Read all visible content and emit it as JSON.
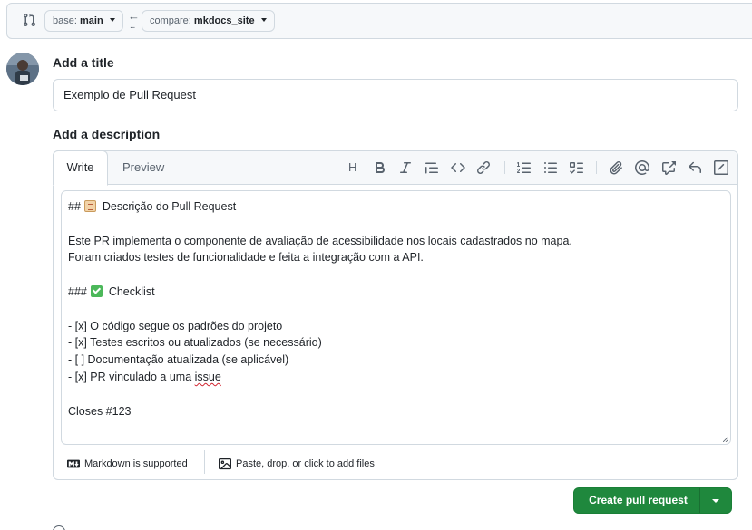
{
  "compare": {
    "base_key": "base:",
    "base_value": "main",
    "compare_key": "compare:",
    "compare_value": "mkdocs_site"
  },
  "title_section": {
    "heading": "Add a title",
    "value": "Exemplo de Pull Request"
  },
  "description_section": {
    "heading": "Add a description",
    "tabs": {
      "write": "Write",
      "preview": "Preview"
    },
    "toolbar": {
      "heading_label": "H",
      "icons": [
        "bold-icon",
        "italic-icon",
        "quote-icon",
        "code-icon",
        "link-icon",
        "numbered-list-icon",
        "unordered-list-icon",
        "task-list-icon",
        "attach-icon",
        "mention-icon",
        "cross-reference-icon",
        "reply-icon",
        "slash-command-icon"
      ]
    },
    "body_lines": [
      {
        "prefix": "## ",
        "emoji": "clipboard",
        "text": "Descrição do Pull Request"
      },
      {
        "text": ""
      },
      {
        "text": "Este PR implementa o componente de avaliação de acessibilidade nos locais cadastrados no mapa."
      },
      {
        "text": "Foram criados testes de funcionalidade e feita a integração com a API."
      },
      {
        "text": ""
      },
      {
        "prefix": "### ",
        "emoji": "check",
        "text": "Checklist"
      },
      {
        "text": ""
      },
      {
        "text": "- [x] O código segue os padrões do projeto"
      },
      {
        "text": "- [x] Testes escritos ou atualizados (se necessário)"
      },
      {
        "text": "- [ ] Documentação atualizada (se aplicável)"
      },
      {
        "prefix": "- [x] PR vinculado a uma ",
        "misspelled": "issue"
      },
      {
        "text": ""
      },
      {
        "text": "Closes #123"
      }
    ],
    "footer": {
      "markdown": "Markdown is supported",
      "attach": "Paste, drop, or click to add files"
    }
  },
  "actions": {
    "create_label": "Create pull request"
  },
  "colors": {
    "primary_button": "#1f883d",
    "border": "#d1d9e0",
    "muted_text": "#59636e",
    "toolbar_bg": "#f6f8fa"
  }
}
